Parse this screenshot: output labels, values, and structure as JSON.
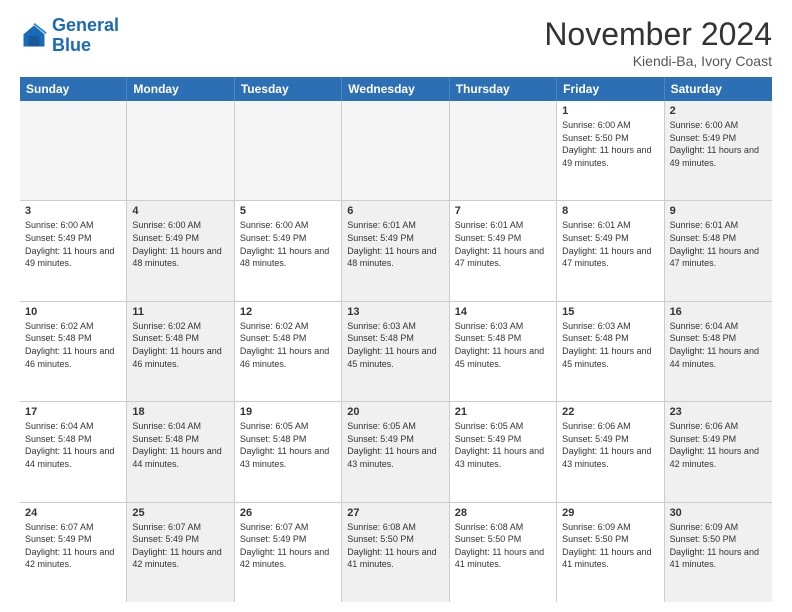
{
  "logo": {
    "line1": "General",
    "line2": "Blue"
  },
  "title": "November 2024",
  "location": "Kiendi-Ba, Ivory Coast",
  "header": {
    "days": [
      "Sunday",
      "Monday",
      "Tuesday",
      "Wednesday",
      "Thursday",
      "Friday",
      "Saturday"
    ]
  },
  "weeks": [
    {
      "cells": [
        {
          "day": "",
          "empty": true
        },
        {
          "day": "",
          "empty": true
        },
        {
          "day": "",
          "empty": true
        },
        {
          "day": "",
          "empty": true
        },
        {
          "day": "",
          "empty": true
        },
        {
          "day": "1",
          "shaded": false,
          "text": "Sunrise: 6:00 AM\nSunset: 5:50 PM\nDaylight: 11 hours and 49 minutes."
        },
        {
          "day": "2",
          "shaded": true,
          "text": "Sunrise: 6:00 AM\nSunset: 5:49 PM\nDaylight: 11 hours and 49 minutes."
        }
      ]
    },
    {
      "cells": [
        {
          "day": "3",
          "shaded": false,
          "text": "Sunrise: 6:00 AM\nSunset: 5:49 PM\nDaylight: 11 hours and 49 minutes."
        },
        {
          "day": "4",
          "shaded": true,
          "text": "Sunrise: 6:00 AM\nSunset: 5:49 PM\nDaylight: 11 hours and 48 minutes."
        },
        {
          "day": "5",
          "shaded": false,
          "text": "Sunrise: 6:00 AM\nSunset: 5:49 PM\nDaylight: 11 hours and 48 minutes."
        },
        {
          "day": "6",
          "shaded": true,
          "text": "Sunrise: 6:01 AM\nSunset: 5:49 PM\nDaylight: 11 hours and 48 minutes."
        },
        {
          "day": "7",
          "shaded": false,
          "text": "Sunrise: 6:01 AM\nSunset: 5:49 PM\nDaylight: 11 hours and 47 minutes."
        },
        {
          "day": "8",
          "shaded": false,
          "text": "Sunrise: 6:01 AM\nSunset: 5:49 PM\nDaylight: 11 hours and 47 minutes."
        },
        {
          "day": "9",
          "shaded": true,
          "text": "Sunrise: 6:01 AM\nSunset: 5:48 PM\nDaylight: 11 hours and 47 minutes."
        }
      ]
    },
    {
      "cells": [
        {
          "day": "10",
          "shaded": false,
          "text": "Sunrise: 6:02 AM\nSunset: 5:48 PM\nDaylight: 11 hours and 46 minutes."
        },
        {
          "day": "11",
          "shaded": true,
          "text": "Sunrise: 6:02 AM\nSunset: 5:48 PM\nDaylight: 11 hours and 46 minutes."
        },
        {
          "day": "12",
          "shaded": false,
          "text": "Sunrise: 6:02 AM\nSunset: 5:48 PM\nDaylight: 11 hours and 46 minutes."
        },
        {
          "day": "13",
          "shaded": true,
          "text": "Sunrise: 6:03 AM\nSunset: 5:48 PM\nDaylight: 11 hours and 45 minutes."
        },
        {
          "day": "14",
          "shaded": false,
          "text": "Sunrise: 6:03 AM\nSunset: 5:48 PM\nDaylight: 11 hours and 45 minutes."
        },
        {
          "day": "15",
          "shaded": false,
          "text": "Sunrise: 6:03 AM\nSunset: 5:48 PM\nDaylight: 11 hours and 45 minutes."
        },
        {
          "day": "16",
          "shaded": true,
          "text": "Sunrise: 6:04 AM\nSunset: 5:48 PM\nDaylight: 11 hours and 44 minutes."
        }
      ]
    },
    {
      "cells": [
        {
          "day": "17",
          "shaded": false,
          "text": "Sunrise: 6:04 AM\nSunset: 5:48 PM\nDaylight: 11 hours and 44 minutes."
        },
        {
          "day": "18",
          "shaded": true,
          "text": "Sunrise: 6:04 AM\nSunset: 5:48 PM\nDaylight: 11 hours and 44 minutes."
        },
        {
          "day": "19",
          "shaded": false,
          "text": "Sunrise: 6:05 AM\nSunset: 5:48 PM\nDaylight: 11 hours and 43 minutes."
        },
        {
          "day": "20",
          "shaded": true,
          "text": "Sunrise: 6:05 AM\nSunset: 5:49 PM\nDaylight: 11 hours and 43 minutes."
        },
        {
          "day": "21",
          "shaded": false,
          "text": "Sunrise: 6:05 AM\nSunset: 5:49 PM\nDaylight: 11 hours and 43 minutes."
        },
        {
          "day": "22",
          "shaded": false,
          "text": "Sunrise: 6:06 AM\nSunset: 5:49 PM\nDaylight: 11 hours and 43 minutes."
        },
        {
          "day": "23",
          "shaded": true,
          "text": "Sunrise: 6:06 AM\nSunset: 5:49 PM\nDaylight: 11 hours and 42 minutes."
        }
      ]
    },
    {
      "cells": [
        {
          "day": "24",
          "shaded": false,
          "text": "Sunrise: 6:07 AM\nSunset: 5:49 PM\nDaylight: 11 hours and 42 minutes."
        },
        {
          "day": "25",
          "shaded": true,
          "text": "Sunrise: 6:07 AM\nSunset: 5:49 PM\nDaylight: 11 hours and 42 minutes."
        },
        {
          "day": "26",
          "shaded": false,
          "text": "Sunrise: 6:07 AM\nSunset: 5:49 PM\nDaylight: 11 hours and 42 minutes."
        },
        {
          "day": "27",
          "shaded": true,
          "text": "Sunrise: 6:08 AM\nSunset: 5:50 PM\nDaylight: 11 hours and 41 minutes."
        },
        {
          "day": "28",
          "shaded": false,
          "text": "Sunrise: 6:08 AM\nSunset: 5:50 PM\nDaylight: 11 hours and 41 minutes."
        },
        {
          "day": "29",
          "shaded": false,
          "text": "Sunrise: 6:09 AM\nSunset: 5:50 PM\nDaylight: 11 hours and 41 minutes."
        },
        {
          "day": "30",
          "shaded": true,
          "text": "Sunrise: 6:09 AM\nSunset: 5:50 PM\nDaylight: 11 hours and 41 minutes."
        }
      ]
    }
  ]
}
